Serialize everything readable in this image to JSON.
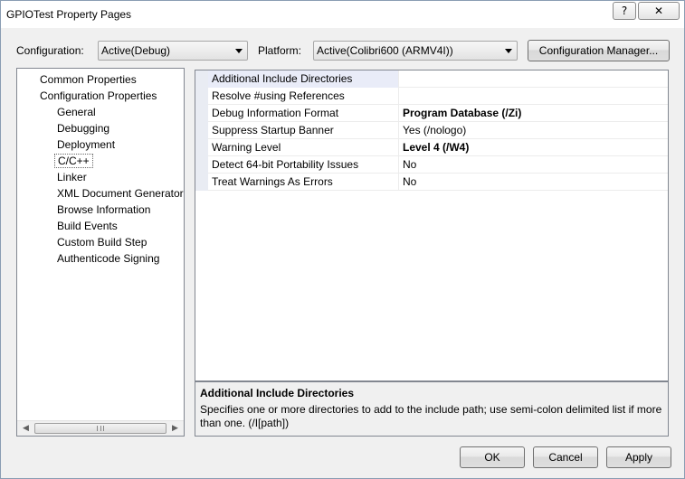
{
  "window": {
    "title": "GPIOTest Property Pages",
    "help_glyph": "?",
    "close_glyph": "✕"
  },
  "config": {
    "configuration_label": "Configuration:",
    "configuration_value": "Active(Debug)",
    "platform_label": "Platform:",
    "platform_value": "Active(Colibri600 (ARMV4I))",
    "manager_button": "Configuration Manager..."
  },
  "tree": {
    "items": [
      {
        "label": "Common Properties"
      },
      {
        "label": "Configuration Properties"
      },
      {
        "label": "General"
      },
      {
        "label": "Debugging"
      },
      {
        "label": "Deployment"
      },
      {
        "label": "C/C++"
      },
      {
        "label": "Linker"
      },
      {
        "label": "XML Document Generator"
      },
      {
        "label": "Browse Information"
      },
      {
        "label": "Build Events"
      },
      {
        "label": "Custom Build Step"
      },
      {
        "label": "Authenticode Signing"
      }
    ],
    "selected": "C/C++",
    "scroll_left": "◀",
    "scroll_right": "▶"
  },
  "properties": {
    "rows": [
      {
        "name": "Additional Include Directories",
        "value": ""
      },
      {
        "name": "Resolve #using References",
        "value": ""
      },
      {
        "name": "Debug Information Format",
        "value": "Program Database (/Zi)"
      },
      {
        "name": "Suppress Startup Banner",
        "value": "Yes (/nologo)"
      },
      {
        "name": "Warning Level",
        "value": "Level 4 (/W4)"
      },
      {
        "name": "Detect 64-bit Portability Issues",
        "value": "No"
      },
      {
        "name": "Treat Warnings As Errors",
        "value": "No"
      }
    ],
    "bold_values": [
      "Program Database (/Zi)",
      "Level 4 (/W4)"
    ]
  },
  "description": {
    "title": "Additional Include Directories",
    "text": "Specifies one or more directories to add to the include path; use semi-colon delimited list if more than one.     (/I[path])"
  },
  "buttons": {
    "ok": "OK",
    "cancel": "Cancel",
    "apply": "Apply"
  }
}
